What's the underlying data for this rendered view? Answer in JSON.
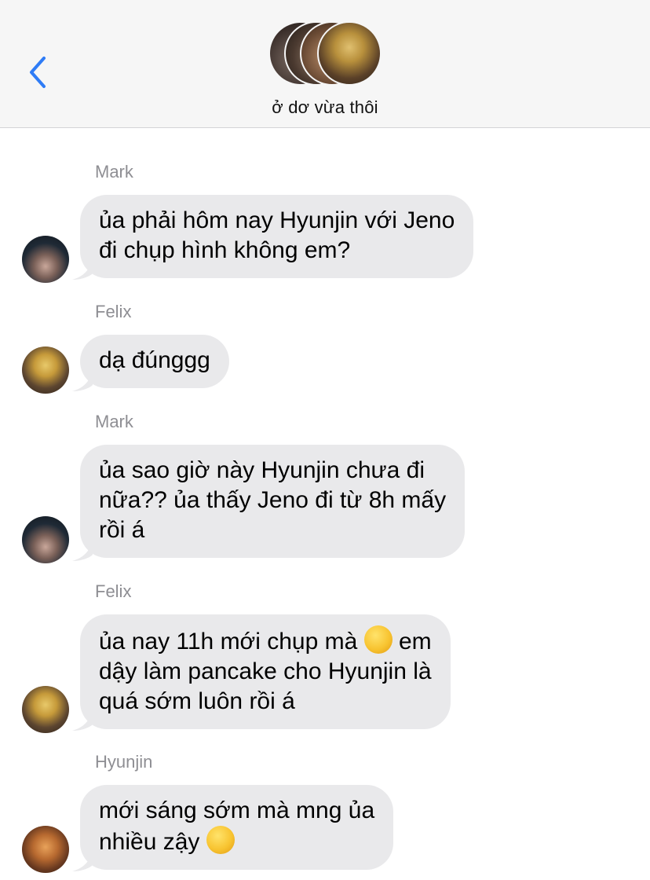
{
  "header": {
    "back_icon": "chevron-left-icon",
    "group_name": "ở dơ vừa thôi",
    "accent_color": "#2f7cf6"
  },
  "messages": [
    {
      "sender": "Mark",
      "lines": [
        "ủa phải hôm nay Hyunjin với Jeno",
        "đi chụp hình không em?"
      ]
    },
    {
      "sender": "Felix",
      "lines": [
        "dạ đúnggg"
      ]
    },
    {
      "sender": "Mark",
      "lines": [
        "ủa sao giờ này Hyunjin chưa đi",
        "nữa?? ủa thấy Jeno đi từ 8h mấy",
        "rồi á"
      ]
    },
    {
      "sender": "Felix",
      "lines": [
        "ủa nay 11h mới chụp mà",
        "em",
        "dậy làm pancake cho Hyunjin là",
        "quá sớm luôn rồi á"
      ],
      "emoji": "thinking-face-emoji"
    },
    {
      "sender": "Hyunjin",
      "lines": [
        "mới sáng sớm mà mng ủa",
        "nhiều zậy"
      ],
      "emoji": "yawning-face-emoji"
    }
  ],
  "colors": {
    "bubble_gray": "#e9e9eb",
    "sender_gray": "#8e8e93",
    "header_bg": "#f6f6f6"
  }
}
